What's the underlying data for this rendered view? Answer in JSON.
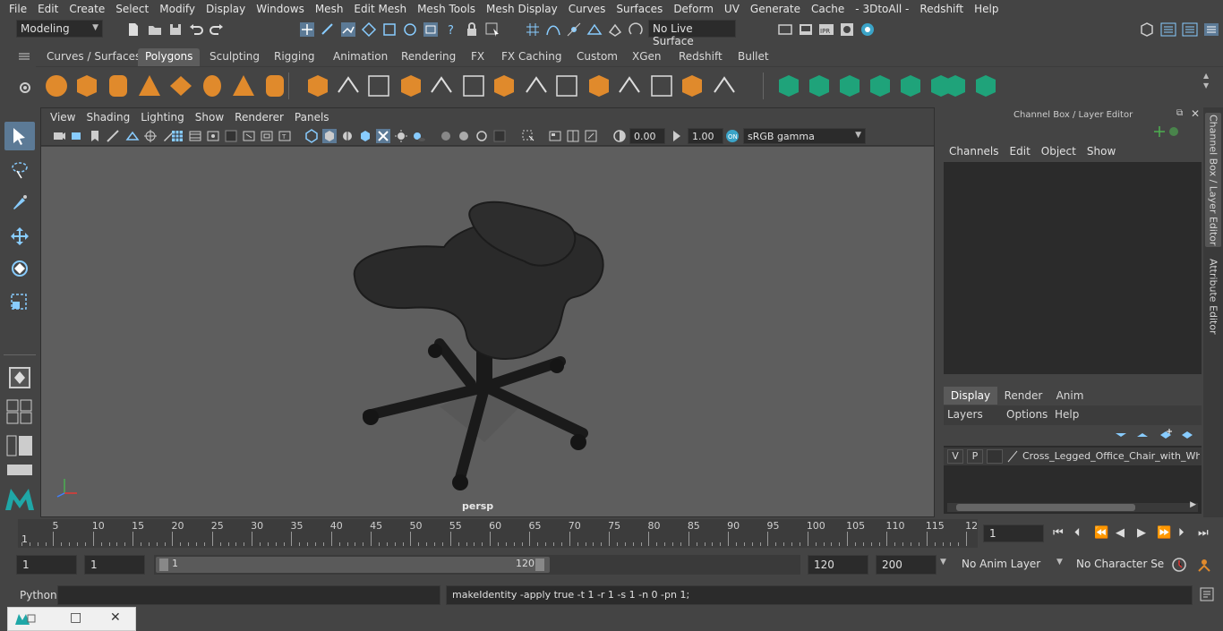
{
  "menubar": {
    "items": [
      "File",
      "Edit",
      "Create",
      "Select",
      "Modify",
      "Display",
      "Windows",
      "Mesh",
      "Edit Mesh",
      "Mesh Tools",
      "Mesh Display",
      "Curves",
      "Surfaces",
      "Deform",
      "UV",
      "Generate",
      "Cache",
      "- 3DtoAll -",
      "Redshift",
      "Help"
    ]
  },
  "status": {
    "mode": "Modeling",
    "live_surface": "No Live Surface"
  },
  "shelf_tabs": [
    "Curves / Surfaces",
    "Polygons",
    "Sculpting",
    "Rigging",
    "Animation",
    "Rendering",
    "FX",
    "FX Caching",
    "Custom",
    "XGen",
    "Redshift",
    "Bullet"
  ],
  "shelf_active": "Polygons",
  "viewport": {
    "menu": [
      "View",
      "Shading",
      "Lighting",
      "Show",
      "Renderer",
      "Panels"
    ],
    "exposure": "0.00",
    "gamma": "1.00",
    "colorspace": "sRGB gamma",
    "camera": "persp"
  },
  "channel_box": {
    "title": "Channel Box / Layer Editor",
    "menu": [
      "Channels",
      "Edit",
      "Object",
      "Show"
    ]
  },
  "layer_editor": {
    "tabs": [
      "Display",
      "Render",
      "Anim"
    ],
    "active_tab": "Display",
    "menu": [
      "Layers",
      "Options",
      "Help"
    ],
    "layer": {
      "v": "V",
      "p": "P",
      "name": "Cross_Legged_Office_Chair_with_Whe"
    }
  },
  "side_tabs": [
    "Channel Box / Layer Editor",
    "Attribute Editor"
  ],
  "timeline": {
    "ticks": [
      5,
      10,
      15,
      20,
      25,
      30,
      35,
      40,
      45,
      50,
      55,
      60,
      65,
      70,
      75,
      80,
      85,
      90,
      95,
      100,
      105,
      110,
      115,
      12
    ],
    "start_label": "1",
    "current_frame": "1"
  },
  "range": {
    "start": "1",
    "playback_start": "1",
    "slider_start": "1",
    "slider_end": "120",
    "playback_end": "120",
    "end": "200",
    "anim_layer": "No Anim Layer",
    "character_set": "No Character Set"
  },
  "command": {
    "language": "Python",
    "result": "makeIdentity -apply true -t 1 -r 1 -s 1 -n 0 -pn 1;"
  },
  "colors": {
    "shelf_orange": "#e08a2c",
    "shelf_green": "#1fa37a",
    "select_blue": "#5c7a96"
  }
}
